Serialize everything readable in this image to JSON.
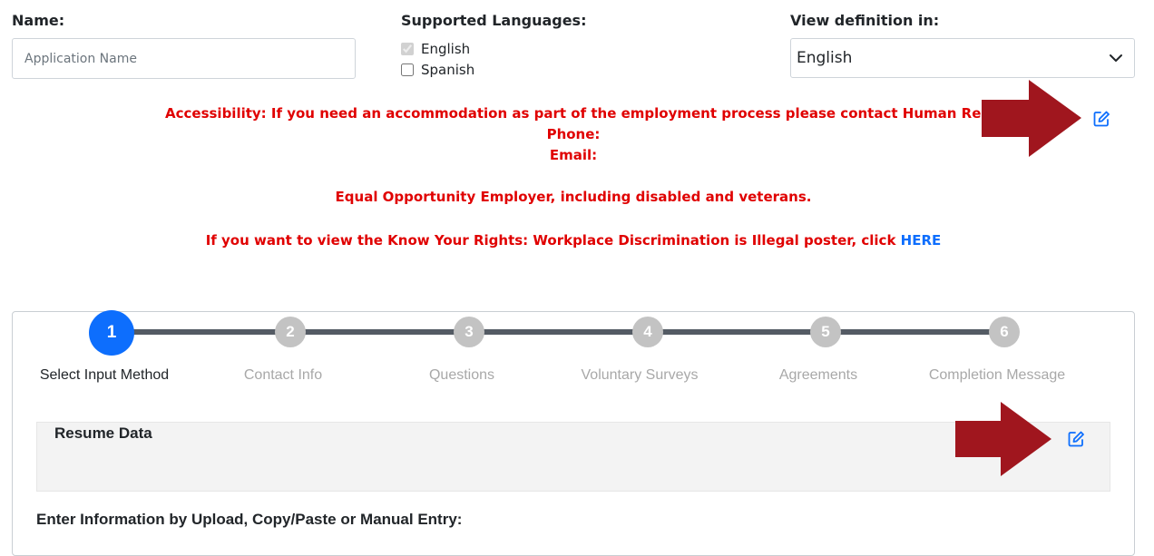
{
  "form": {
    "name_label": "Name:",
    "name_placeholder": "Application Name",
    "languages_label": "Supported Languages:",
    "languages": [
      {
        "label": "English",
        "checked": true,
        "disabled": true
      },
      {
        "label": "Spanish",
        "checked": false,
        "disabled": false
      }
    ],
    "view_label": "View definition in:",
    "view_selected": "English"
  },
  "notice": {
    "accessibility_text": "Accessibility: If you need an accommodation as part of the employment process please contact Human Resources at",
    "phone_label": "Phone:",
    "email_label": "Email:",
    "eoe_text": "Equal Opportunity Employer, including disabled and veterans.",
    "rights_text": "If you want to view the Know Your Rights: Workplace Discrimination is Illegal poster, click",
    "rights_link": "HERE"
  },
  "wizard": {
    "steps": [
      {
        "number": "1",
        "label": "Select Input Method",
        "active": true
      },
      {
        "number": "2",
        "label": "Contact Info",
        "active": false
      },
      {
        "number": "3",
        "label": "Questions",
        "active": false
      },
      {
        "number": "4",
        "label": "Voluntary Surveys",
        "active": false
      },
      {
        "number": "5",
        "label": "Agreements",
        "active": false
      },
      {
        "number": "6",
        "label": "Completion Message",
        "active": false
      }
    ],
    "resume_title": "Resume Data",
    "enter_title": "Enter Information by Upload, Copy/Paste or Manual Entry:"
  },
  "colors": {
    "accent": "#0d6efd",
    "notice_red": "#e00000",
    "annotation_arrow": "#a0161e",
    "step_inactive": "#c3c3c3",
    "track": "#545b64"
  },
  "icons": [
    "edit-icon",
    "chevron-down-icon",
    "arrow-right-annotation"
  ]
}
